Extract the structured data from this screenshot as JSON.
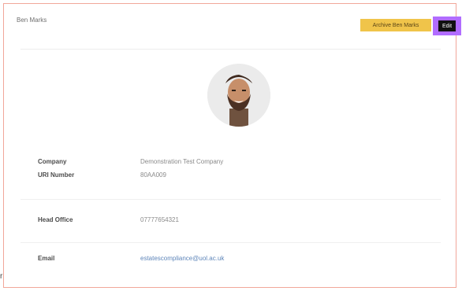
{
  "profile": {
    "name": "Ben Marks",
    "archive_label": "Archive Ben Marks",
    "edit_label": "Edit"
  },
  "details": {
    "company_label": "Company",
    "company_value": "Demonstration Test Company",
    "urn_label": "URI Number",
    "urn_value": "80AA009",
    "head_office_label": "Head Office",
    "head_office_value": "07777654321",
    "email_label": "Email",
    "email_value": "estatescompliance@uol.ac.uk"
  },
  "edge_text": "r",
  "colors": {
    "accent": "#f0c44a",
    "highlight": "#b16cff",
    "card_border": "#f1a79a",
    "link": "#5f86ba"
  }
}
